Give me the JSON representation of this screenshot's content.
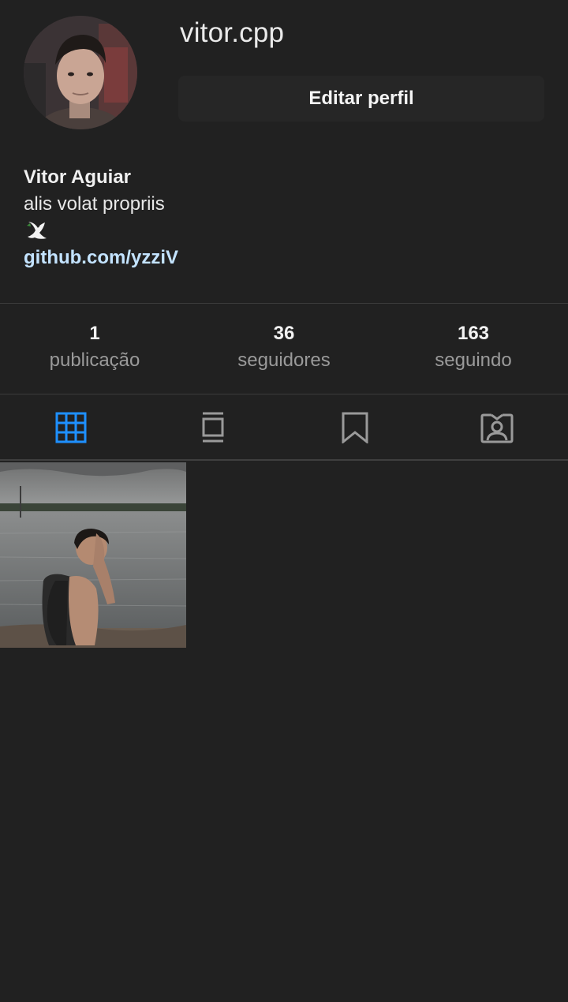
{
  "profile": {
    "username": "vitor.cpp",
    "edit_button": "Editar perfil",
    "full_name": "Vitor Aguiar",
    "bio": "alis volat propriis",
    "bio_emoji": "🕊️",
    "link": "github.com/yzziV"
  },
  "stats": [
    {
      "value": "1",
      "label": "publicação"
    },
    {
      "value": "36",
      "label": "seguidores"
    },
    {
      "value": "163",
      "label": "seguindo"
    }
  ],
  "tabs": [
    {
      "icon": "grid-icon",
      "active": true
    },
    {
      "icon": "feed-icon",
      "active": false
    },
    {
      "icon": "bookmark-icon",
      "active": false
    },
    {
      "icon": "tagged-icon",
      "active": false
    }
  ],
  "colors": {
    "background": "#212121",
    "active_tab": "#1e90ff",
    "inactive_tab": "#9a9a9a",
    "link": "#c3e3ff"
  }
}
